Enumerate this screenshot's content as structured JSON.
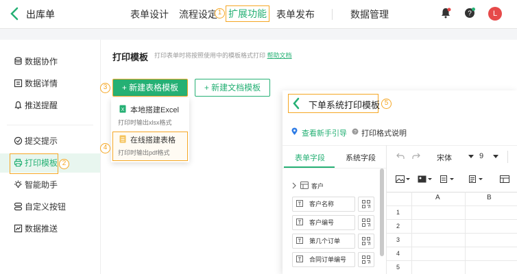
{
  "header": {
    "title": "出库单",
    "nav": [
      "表单设计",
      "流程设定",
      "扩展功能",
      "表单发布",
      "数据管理"
    ],
    "avatar_letter": "L",
    "accent": "#25b074",
    "highlight": "#f5a623"
  },
  "markers": [
    "1",
    "2",
    "3",
    "4",
    "5"
  ],
  "sidebar": {
    "items": [
      {
        "label": "数据协作",
        "icon": "database-icon"
      },
      {
        "label": "数据详情",
        "icon": "detail-icon"
      },
      {
        "label": "推送提醒",
        "icon": "bell-icon"
      },
      {
        "label": "提交提示",
        "icon": "check-circle-icon"
      },
      {
        "label": "打印模板",
        "icon": "printer-icon"
      },
      {
        "label": "智能助手",
        "icon": "bulb-icon"
      },
      {
        "label": "自定义按钮",
        "icon": "buttons-icon"
      },
      {
        "label": "数据推送",
        "icon": "chart-icon"
      }
    ]
  },
  "main": {
    "title": "打印模板",
    "desc": "打印表单时将按照使用中的模板格式打印",
    "help_link": "帮助文档",
    "btn_new_table": "+ 新建表格模板",
    "btn_new_doc": "+ 新建文档模板",
    "dropdown": [
      {
        "title": "本地搭建Excel",
        "sub": "打印时输出xlsx格式"
      },
      {
        "title": "在线搭建表格",
        "sub": "打印时输出pdf格式"
      }
    ]
  },
  "preview": {
    "title": "下单系统打印模板",
    "guide": "查看新手引导",
    "help": "打印格式说明",
    "tabs": [
      "表单字段",
      "系统字段"
    ],
    "group": "客户",
    "fields": [
      "客户名称",
      "客户编号",
      "第几个订单",
      "合同订单编号"
    ],
    "font": "宋体",
    "font_size": "9",
    "columns": [
      "A",
      "B"
    ],
    "rows": [
      "1",
      "2",
      "3",
      "4",
      "5"
    ]
  }
}
